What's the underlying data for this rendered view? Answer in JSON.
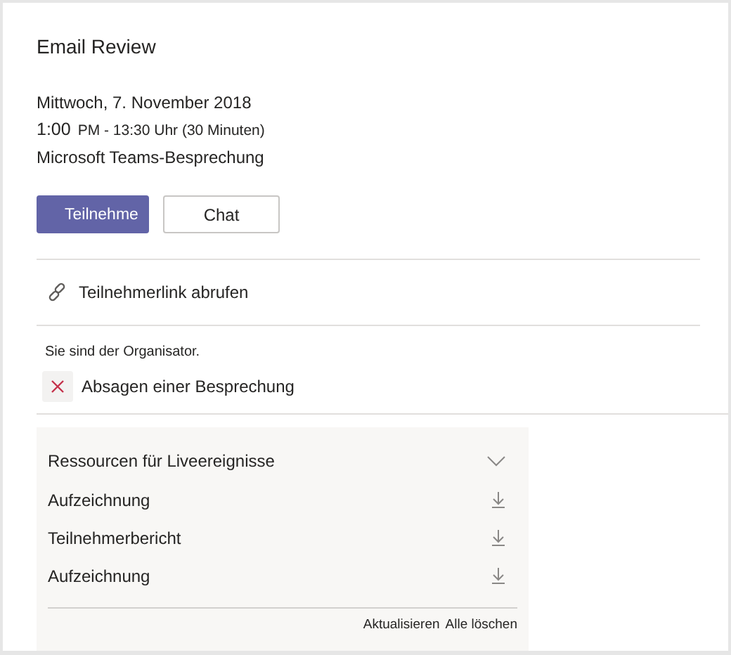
{
  "title": "Email Review",
  "date": "Mittwoch, 7. November 2018",
  "time_start": "1:00",
  "time_rest": "PM - 13:30 Uhr (30 Minuten)",
  "meeting_type": "Microsoft Teams-Besprechung",
  "buttons": [
    {
      "label": "Teilnehme",
      "kind": "primary"
    },
    {
      "label": "Chat",
      "kind": "secondary"
    }
  ],
  "link": "Teilnehmerlink abrufen",
  "organizer_note": "Sie sind der Organisator.",
  "cancel": "Absagen einer Besprechung",
  "resources": {
    "title": "Ressourcen für Liveereignisse",
    "items": [
      {
        "label": "Aufzeichnung"
      },
      {
        "label": "Teilnehmerbericht"
      },
      {
        "label": "Aufzeichnung"
      }
    ],
    "actions": [
      "Aktualisieren",
      "Alle löschen"
    ]
  }
}
